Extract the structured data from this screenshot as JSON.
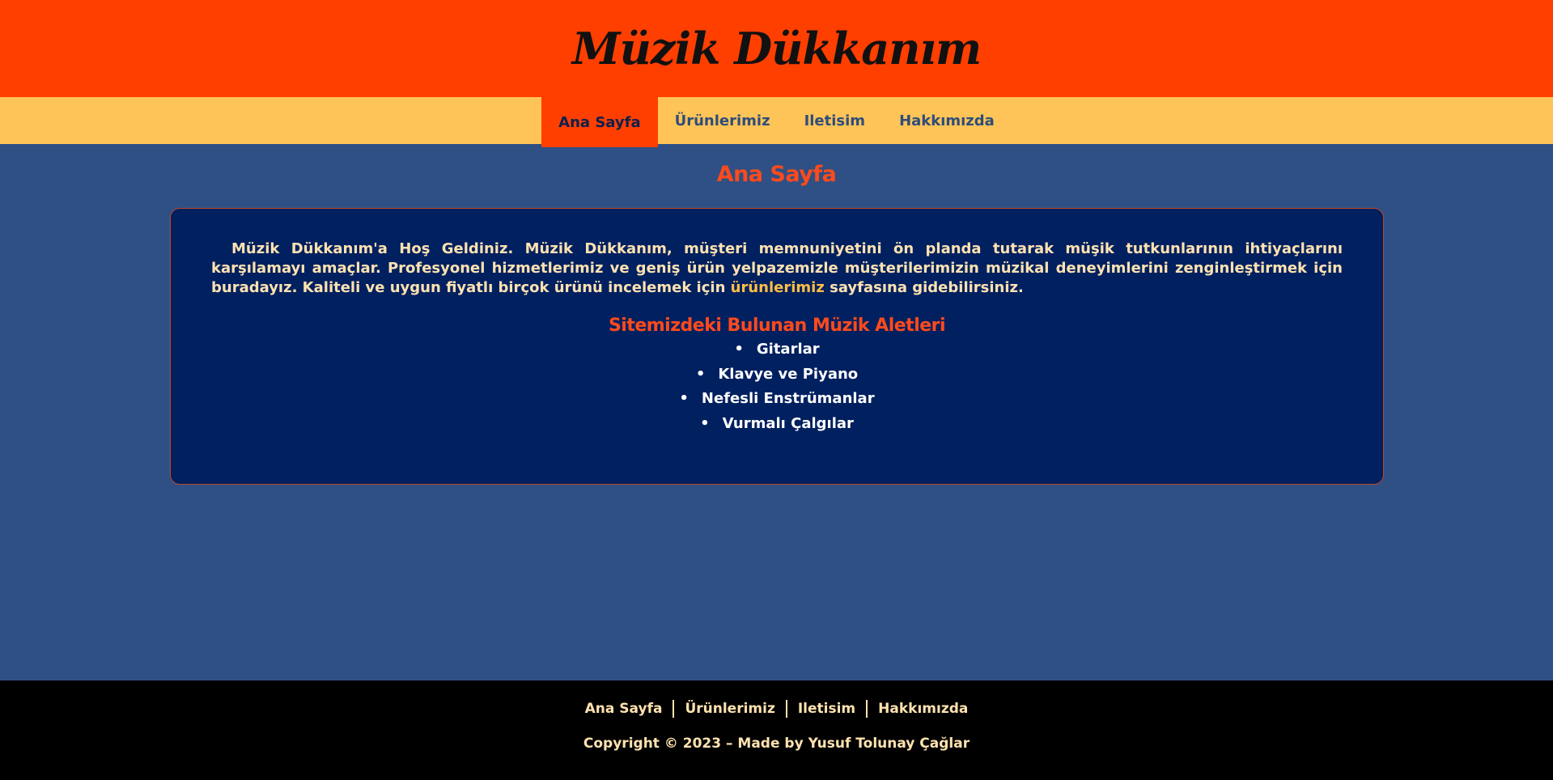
{
  "header": {
    "title": "Müzik Dükkanım"
  },
  "nav": {
    "items": [
      {
        "label": "Ana Sayfa",
        "active": true
      },
      {
        "label": "Ürünlerimiz",
        "active": false
      },
      {
        "label": "Iletisim",
        "active": false
      },
      {
        "label": "Hakkımızda",
        "active": false
      }
    ]
  },
  "main": {
    "heading": "Ana Sayfa",
    "intro": {
      "text_before_link": "Müzik Dükkanım'a Hoş Geldiniz. Müzik Dükkanım, müşteri memnuniyetini ön planda tutarak müşik tutkunlarının ihtiyaçlarını karşılamayı amaçlar. Profesyonel hizmetlerimiz ve geniş ürün yelpazemizle müşterilerimizin müzikal deneyimlerini zenginleştirmek için buradayız. Kaliteli ve uygun fiyatlı birçok ürünü incelemek için",
      "link_text": "ürünlerimiz",
      "text_after_link": "sayfasına gidebilirsiniz."
    },
    "instruments_heading": "Sitemizdeki Bulunan Müzik Aletleri",
    "instruments": [
      "Gitarlar",
      "Klavye ve Piyano",
      "Nefesli Enstrümanlar",
      "Vurmalı Çalgılar"
    ]
  },
  "footer": {
    "links": [
      "Ana Sayfa",
      "Ürünlerimiz",
      "Iletisim",
      "Hakkımızda"
    ],
    "copyright": "Copyright © 2023 – Made by Yusuf Tolunay Çağlar"
  },
  "colors": {
    "header_bg": "#ff3f00",
    "nav_bg": "#ffc457",
    "page_bg": "#2e5085",
    "card_bg": "#002060",
    "accent": "#ff4a1c",
    "footer_bg": "#000000"
  }
}
